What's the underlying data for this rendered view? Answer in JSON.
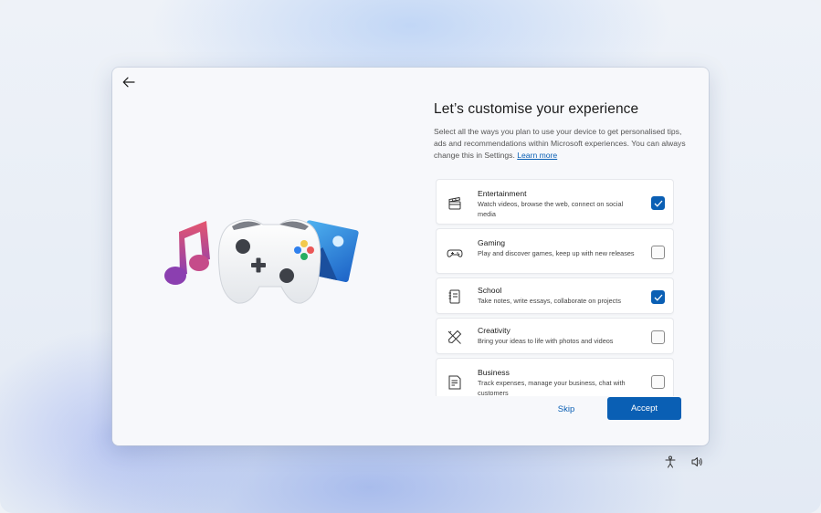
{
  "dialog": {
    "title": "Let’s customise your experience",
    "description": "Select all the ways you plan to use your device to get personalised tips, ads and recommendations within Microsoft experiences. You can always change this in Settings.",
    "learn_more": "Learn more",
    "categories": [
      {
        "name": "Entertainment",
        "desc": "Watch videos, browse the web, connect on social media",
        "checked": true,
        "icon": "clapperboard-icon"
      },
      {
        "name": "Gaming",
        "desc": "Play and discover games, keep up with new releases",
        "checked": false,
        "icon": "gamepad-icon"
      },
      {
        "name": "School",
        "desc": "Take notes, write essays, collaborate on projects",
        "checked": true,
        "icon": "notebook-icon"
      },
      {
        "name": "Creativity",
        "desc": "Bring your ideas to life with photos and videos",
        "checked": false,
        "icon": "pen-ruler-icon"
      },
      {
        "name": "Business",
        "desc": "Track expenses, manage your business, chat with customers",
        "checked": false,
        "icon": "document-icon"
      }
    ],
    "skip_label": "Skip",
    "accept_label": "Accept"
  },
  "colors": {
    "accent": "#0a5fb4",
    "dialog_bg": "#f7f8fb"
  },
  "taskbar": {
    "icons": [
      "accessibility-icon",
      "volume-icon"
    ]
  }
}
